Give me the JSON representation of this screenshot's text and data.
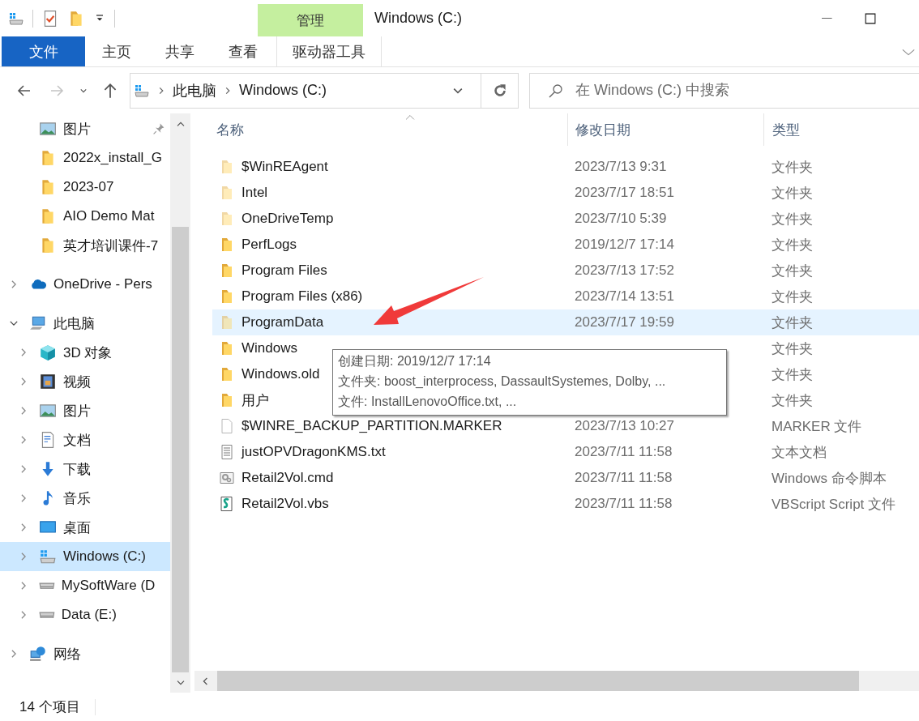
{
  "window": {
    "title": "Windows (C:)"
  },
  "context_tab_group": {
    "label": "管理"
  },
  "ribbon_tabs": [
    {
      "label": "文件",
      "kind": "file-menu",
      "selected": false
    },
    {
      "label": "主页",
      "kind": "tab",
      "selected": false
    },
    {
      "label": "共享",
      "kind": "tab",
      "selected": false
    },
    {
      "label": "查看",
      "kind": "tab",
      "selected": false
    },
    {
      "label": "驱动器工具",
      "kind": "contextual",
      "selected": false
    }
  ],
  "address_bar": {
    "segments": [
      "此电脑",
      "Windows (C:)"
    ]
  },
  "search": {
    "placeholder": "在 Windows (C:) 中搜索"
  },
  "sidebar": {
    "quick_access": [
      {
        "label": "图片",
        "kind": "pictures",
        "pinned": true,
        "selected": false
      },
      {
        "label": "2022x_install_G",
        "kind": "folder",
        "pinned": false,
        "selected": false
      },
      {
        "label": "2023-07",
        "kind": "folder",
        "pinned": false,
        "selected": false
      },
      {
        "label": "AIO Demo Mat",
        "kind": "folder",
        "pinned": false,
        "selected": false
      },
      {
        "label": "英才培训课件-7",
        "kind": "folder",
        "pinned": false,
        "selected": false
      }
    ],
    "tree": [
      {
        "label": "OneDrive - Pers",
        "kind": "onedrive",
        "expanded": false,
        "selected": false
      },
      {
        "label": "此电脑",
        "kind": "pc",
        "expanded": true,
        "selected": false,
        "children": [
          {
            "label": "3D 对象",
            "kind": "cube",
            "expanded": false,
            "selected": false
          },
          {
            "label": "视频",
            "kind": "video",
            "expanded": false,
            "selected": false
          },
          {
            "label": "图片",
            "kind": "pictures",
            "expanded": false,
            "selected": false
          },
          {
            "label": "文档",
            "kind": "docs",
            "expanded": false,
            "selected": false
          },
          {
            "label": "下载",
            "kind": "download",
            "expanded": false,
            "selected": false
          },
          {
            "label": "音乐",
            "kind": "music",
            "expanded": false,
            "selected": false
          },
          {
            "label": "桌面",
            "kind": "desktop",
            "expanded": false,
            "selected": false
          },
          {
            "label": "Windows (C:)",
            "kind": "drive-windows",
            "expanded": false,
            "selected": true
          },
          {
            "label": "MySoftWare (D",
            "kind": "drive",
            "expanded": false,
            "selected": false
          },
          {
            "label": "Data (E:)",
            "kind": "drive",
            "expanded": false,
            "selected": false
          }
        ]
      },
      {
        "label": "网络",
        "kind": "network",
        "expanded": false,
        "selected": false
      }
    ]
  },
  "file_list": {
    "columns": [
      {
        "label": "名称",
        "sorted": true
      },
      {
        "label": "修改日期",
        "sorted": false
      },
      {
        "label": "类型",
        "sorted": false
      }
    ],
    "rows": [
      {
        "name": "$WinREAgent",
        "date": "2023/7/13 9:31",
        "type": "文件夹",
        "kind": "folder",
        "hidden": true,
        "selected": false
      },
      {
        "name": "Intel",
        "date": "2023/7/17 18:51",
        "type": "文件夹",
        "kind": "folder",
        "hidden": true,
        "selected": false
      },
      {
        "name": "OneDriveTemp",
        "date": "2023/7/10 5:39",
        "type": "文件夹",
        "kind": "folder",
        "hidden": true,
        "selected": false
      },
      {
        "name": "PerfLogs",
        "date": "2019/12/7 17:14",
        "type": "文件夹",
        "kind": "folder",
        "hidden": false,
        "selected": false
      },
      {
        "name": "Program Files",
        "date": "2023/7/13 17:52",
        "type": "文件夹",
        "kind": "folder",
        "hidden": false,
        "selected": false
      },
      {
        "name": "Program Files (x86)",
        "date": "2023/7/14 13:51",
        "type": "文件夹",
        "kind": "folder",
        "hidden": false,
        "selected": false
      },
      {
        "name": "ProgramData",
        "date": "2023/7/17 19:59",
        "type": "文件夹",
        "kind": "folder",
        "hidden": true,
        "selected": true
      },
      {
        "name": "Windows",
        "type": "文件夹",
        "kind": "folder",
        "hidden": false,
        "selected": false
      },
      {
        "name": "Windows.old",
        "type": "文件夹",
        "kind": "folder",
        "hidden": false,
        "selected": false
      },
      {
        "name": "用户",
        "type": "文件夹",
        "kind": "folder",
        "hidden": false,
        "selected": false
      },
      {
        "name": "$WINRE_BACKUP_PARTITION.MARKER",
        "date": "2023/7/13 10:27",
        "type": "MARKER 文件",
        "kind": "file",
        "hidden": false,
        "selected": false
      },
      {
        "name": "justOPVDragonKMS.txt",
        "date": "2023/7/11 11:58",
        "type": "文本文档",
        "kind": "text",
        "hidden": false,
        "selected": false
      },
      {
        "name": "Retail2Vol.cmd",
        "date": "2023/7/11 11:58",
        "type": "Windows 命令脚本",
        "kind": "cmd",
        "hidden": false,
        "selected": false
      },
      {
        "name": "Retail2Vol.vbs",
        "date": "2023/7/11 11:58",
        "type": "VBScript Script 文件",
        "kind": "vbs",
        "hidden": false,
        "selected": false
      }
    ]
  },
  "tooltip": {
    "lines": [
      "创建日期: 2019/12/7 17:14",
      "文件夹: boost_interprocess, DassaultSystemes, Dolby, ...",
      "文件: InstallLenovoOffice.txt, ..."
    ]
  },
  "status_bar": {
    "item_count": "14 个项目"
  }
}
